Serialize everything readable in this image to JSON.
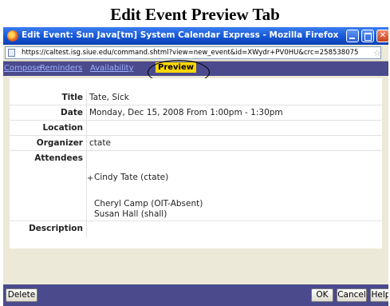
{
  "caption": "Edit Event Preview Tab",
  "window": {
    "title": "Edit Event: Sun Java[tm] System Calendar Express - Mozilla Firefox",
    "url": "https://caltest.isg.siue.edu/command.shtml?view=new_event&id=XWydr+PV0HU&crc=258538075"
  },
  "tabs": {
    "compose": "Compose",
    "reminders": "Reminders",
    "availability": "Availability",
    "preview": "Preview"
  },
  "event": {
    "title_label": "Title",
    "title_value": "Tate, Sick",
    "date_label": "Date",
    "date_value": "Monday, Dec 15, 2008 From 1:00pm - 1:30pm",
    "location_label": "Location",
    "location_value": "",
    "organizer_label": "Organizer",
    "organizer_value": "ctate",
    "attendees_label": "Attendees",
    "attendees": [
      "Cindy Tate (ctate)",
      "Cheryl Camp (OIT-Absent)",
      "Susan Hall (shall)"
    ],
    "attendee_bullet": "+",
    "description_label": "Description",
    "description_value": ""
  },
  "buttons": {
    "delete": "Delete",
    "ok": "OK",
    "cancel": "Cancel",
    "help": "Help"
  },
  "icons": [
    "firefox-icon",
    "minimize-icon",
    "maximize-icon",
    "close-icon",
    "page-icon",
    "bookmark-star-icon"
  ]
}
